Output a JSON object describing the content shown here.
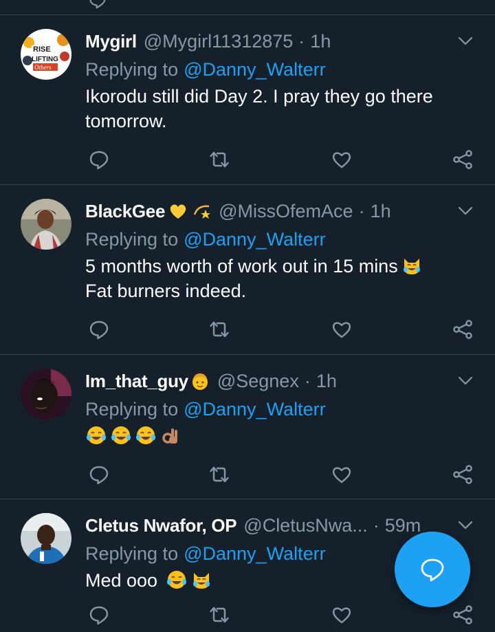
{
  "colors": {
    "background": "#15202b",
    "divider": "#38444d",
    "secondary_text": "#8899a6",
    "accent": "#1da1f2",
    "primary_text": "#ffffff"
  },
  "icons": {
    "reply": "reply-icon",
    "retweet": "retweet-icon",
    "like": "heart-icon",
    "share": "share-icon",
    "menu": "chevron-down-icon",
    "compose": "compose-reply-icon"
  },
  "tweets": [
    {
      "name": "Mygirl",
      "handle": "@Mygirl11312875",
      "separator": "·",
      "time": "1h",
      "replying_prefix": "Replying to",
      "replying_to": "@Danny_Walterr",
      "text_lines": [
        "Ikorodu still did Day 2. I pray they go there",
        "tomorrow."
      ],
      "avatar_lettering": "We RISE by LIFTING Others"
    },
    {
      "name": "BlackGee",
      "name_emojis": [
        "yellow-heart-emoji",
        "dizzy-star-emoji"
      ],
      "handle": "@MissOfemAce",
      "separator": "·",
      "time": "1h",
      "replying_prefix": "Replying to",
      "replying_to": "@Danny_Walterr",
      "text_lines": [
        "5 months worth of work out in 15 mins",
        "Fat burners indeed."
      ],
      "text_emojis": [
        "cat-tears-of-joy-emoji"
      ]
    },
    {
      "name": "Im_that_guy",
      "name_emojis": [
        "boy-face-emoji"
      ],
      "handle": "@Segnex",
      "separator": "·",
      "time": "1h",
      "replying_prefix": "Replying to",
      "replying_to": "@Danny_Walterr",
      "text_emojis": [
        "tears-of-joy-emoji",
        "tears-of-joy-emoji",
        "tears-of-joy-emoji",
        "ok-hand-emoji"
      ]
    },
    {
      "name": "Cletus Nwafor, OP",
      "handle": "@CletusNwa...",
      "separator": "·",
      "time": "59m",
      "replying_prefix": "Replying to",
      "replying_to": "@Danny_Walterr",
      "text_lines": [
        "Med ooo"
      ],
      "text_emojis": [
        "tears-of-joy-emoji",
        "cat-tears-of-joy-emoji"
      ]
    }
  ]
}
